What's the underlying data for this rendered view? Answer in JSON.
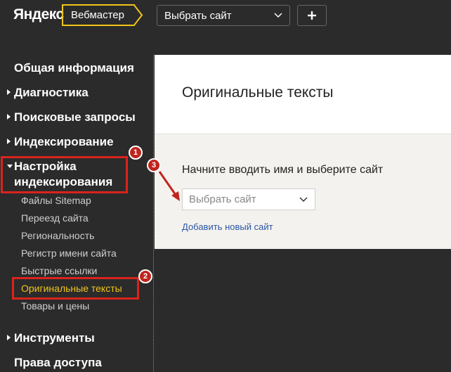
{
  "topbar": {
    "logo": "Яндекс",
    "service": "Вебмастер",
    "site_select": "Выбрать сайт",
    "add_button": "+"
  },
  "sidebar": {
    "items": [
      {
        "label": "Общая информация"
      },
      {
        "label": "Диагностика"
      },
      {
        "label": "Поисковые запросы"
      },
      {
        "label": "Индексирование"
      },
      {
        "label": "Настройка индексирования"
      },
      {
        "label": "Инструменты"
      },
      {
        "label": "Права доступа"
      }
    ],
    "settings_label_line1": "Настройка",
    "settings_label_line2": "индексирования",
    "subitems": [
      {
        "label": "Файлы Sitemap"
      },
      {
        "label": "Переезд сайта"
      },
      {
        "label": "Региональность"
      },
      {
        "label": "Регистр имени сайта"
      },
      {
        "label": "Быстрые ссылки"
      },
      {
        "label": "Оригинальные тексты"
      },
      {
        "label": "Товары и цены"
      }
    ]
  },
  "annotations": {
    "step1": "1",
    "step2": "2",
    "step3": "3"
  },
  "main": {
    "title": "Оригинальные тексты",
    "prompt": "Начните вводить имя и выберите сайт",
    "select_placeholder": "Выбрать сайт",
    "add_site_link": "Добавить новый сайт"
  },
  "colors": {
    "accent": "#f0c419",
    "annotation": "#d9241c",
    "link": "#2a56a8"
  },
  "icons": [
    "chevron-down-icon",
    "plus-icon",
    "triangle-right-icon",
    "triangle-down-icon",
    "arrow-annotation-icon"
  ]
}
